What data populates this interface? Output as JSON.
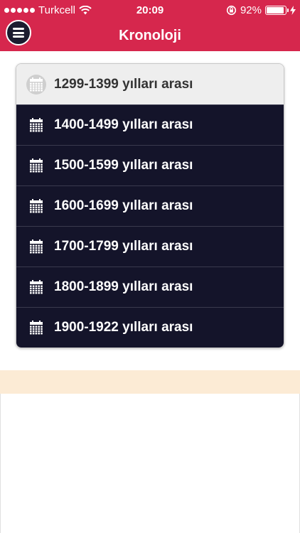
{
  "status_bar": {
    "carrier": "Turkcell",
    "time": "20:09",
    "battery_percent": "92%",
    "battery_level": 0.92,
    "signal_bars": 5
  },
  "nav": {
    "title": "Kronoloji",
    "menu_icon": "hamburger-menu-icon"
  },
  "periods": [
    {
      "label": "1299-1399 yılları arası",
      "active": true
    },
    {
      "label": "1400-1499 yılları arası",
      "active": false
    },
    {
      "label": "1500-1599 yılları arası",
      "active": false
    },
    {
      "label": "1600-1699 yılları arası",
      "active": false
    },
    {
      "label": "1700-1799 yılları arası",
      "active": false
    },
    {
      "label": "1800-1899 yılları arası",
      "active": false
    },
    {
      "label": "1900-1922 yılları arası",
      "active": false
    }
  ],
  "colors": {
    "header": "#d6274d",
    "list_item_bg": "#14142a",
    "active_item_bg": "#eeeeee",
    "footer_band": "#fcebd5"
  }
}
